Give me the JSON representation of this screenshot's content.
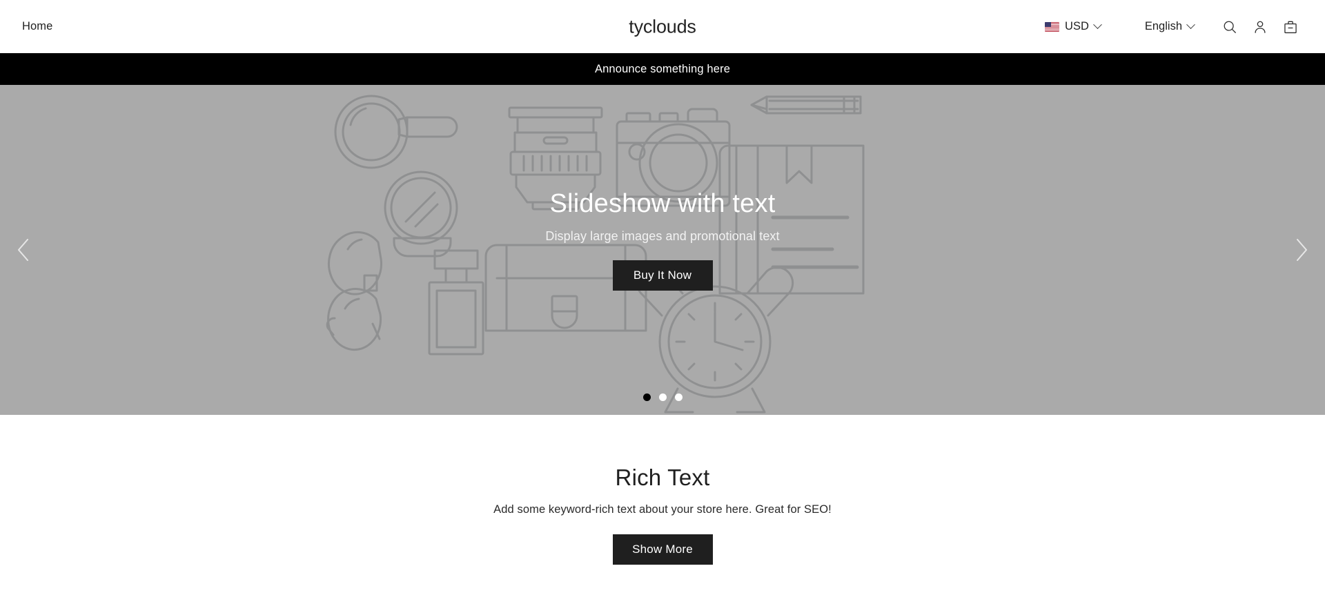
{
  "header": {
    "nav": [
      {
        "label": "Home",
        "name": "nav-link-home"
      }
    ],
    "brand": "tyclouds",
    "currency": {
      "label": "USD",
      "flag": "us-flag-icon",
      "chevron": "chevron-down-icon"
    },
    "language": {
      "label": "English",
      "chevron": "chevron-down-icon"
    },
    "icons": [
      {
        "name": "search-icon",
        "label": "Search"
      },
      {
        "name": "account-icon",
        "label": "Account"
      },
      {
        "name": "cart-icon",
        "label": "Cart"
      }
    ]
  },
  "announcement": {
    "text": "Announce something here"
  },
  "hero": {
    "title": "Slideshow with text",
    "subtitle": "Display large images and promotional text",
    "cta_label": "Buy It Now",
    "prev_label": "Previous slide",
    "next_label": "Next slide",
    "slides": [
      {
        "index": 1,
        "active": true
      },
      {
        "index": 2,
        "active": false
      },
      {
        "index": 3,
        "active": false
      }
    ],
    "background_color": "#aaaaaa",
    "art_stroke_color": "#8f9091"
  },
  "rich_text": {
    "title": "Rich Text",
    "body": "Add some keyword-rich text about your store here. Great for SEO!",
    "cta_label": "Show More"
  },
  "colors": {
    "accent_dark": "#1f1f1f",
    "announcement_bg": "#000000",
    "page_bg": "#ffffff"
  }
}
